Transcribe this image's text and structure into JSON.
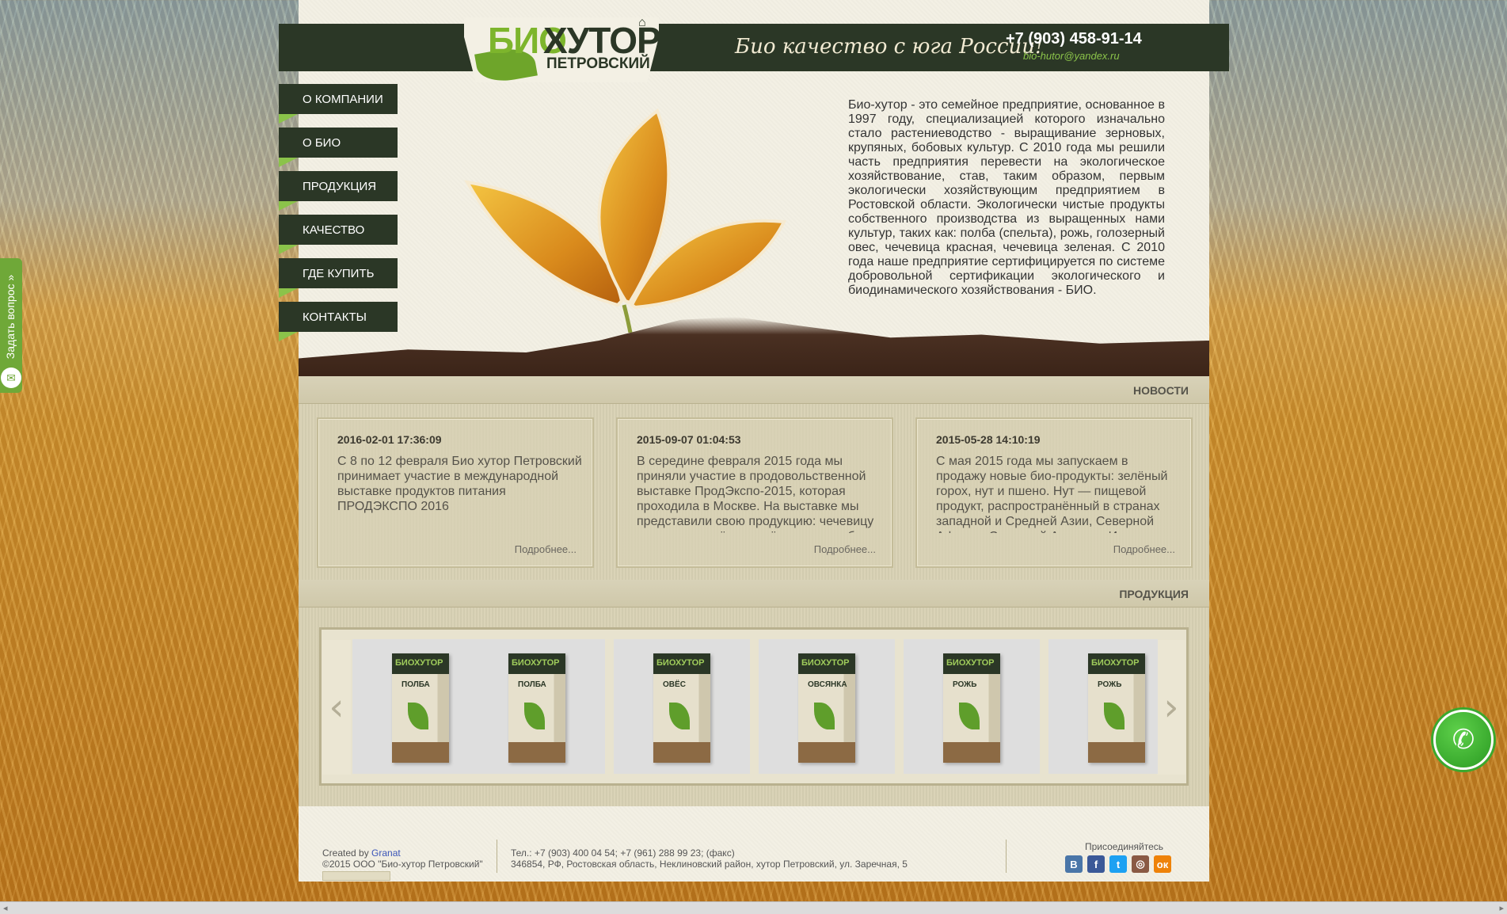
{
  "header": {
    "logo_bio": "БИО",
    "logo_hutor": "ХУТОР",
    "logo_petrovsky": "ПЕТРОВСКИЙ",
    "slogan": "Био качество с юга России!",
    "phone": "+7 (903) 458-91-14",
    "email": "bio-hutor@yandex.ru"
  },
  "nav": {
    "items": [
      {
        "label": "О КОМПАНИИ"
      },
      {
        "label": "О БИО"
      },
      {
        "label": "ПРОДУКЦИЯ"
      },
      {
        "label": "КАЧЕСТВО"
      },
      {
        "label": "ГДЕ КУПИТЬ"
      },
      {
        "label": "КОНТАКТЫ"
      }
    ]
  },
  "intro": {
    "text": "Био-хутор - это семейное предприятие, основанное в 1997 году, специализацией которого изначально стало растениеводство - выращивание зерновых, крупяных, бобовых культур. С 2010 года мы решили часть предприятия перевести на экологическое хозяйствование, став, таким образом, первым экологически хозяйствующим предприятием в Ростовской области. Экологически чистые продукты собственного производства из выращенных нами культур, таких как: полба (спельта), рожь, голозерный овес, чечевица красная, чечевица зеленая. С 2010 года наше предприятие сертифицируется по системе добровольной сертификации экологического и биодинамического хозяйствования - БИО."
  },
  "news": {
    "title": "НОВОСТИ",
    "more_label": "Подробнее...",
    "items": [
      {
        "date": "2016-02-01 17:36:09",
        "text": "С 8 по 12 февраля Био хутор Петровский принимает участие в международной выставке продуктов питания ПРОДЭКСПО 2016"
      },
      {
        "date": "2015-09-07 01:04:53",
        "text": "В середине февраля 2015 года мы приняли участие в продовольственной выставке ПродЭкспо-2015, которая проходила в Москве. На выставке мы представили свою продукцию: чечевицу красную и зелёную, овёс, рожь, полбу"
      },
      {
        "date": "2015-05-28 14:10:19",
        "text": "С мая 2015 года мы запускаем в продажу новые био-продукты: зелёный горох, нут и пшено. Нут — пищевой продукт, распространённый в странах западной и Средней Азии, Северной Африки, Северной Америки. Из него готовят"
      }
    ]
  },
  "products": {
    "title": "ПРОДУКЦИЯ",
    "prev_arrow": "‹",
    "next_arrow": "›",
    "items": [
      {
        "brand": "БИОХУТОР",
        "name": "ПОЛБА"
      },
      {
        "brand": "БИОХУТОР",
        "name": "ПОЛБА"
      },
      {
        "brand": "БИОХУТОР",
        "name": "ОВЁС"
      },
      {
        "brand": "БИОХУТОР",
        "name": "ОВСЯНКА"
      },
      {
        "brand": "БИОХУТОР",
        "name": "РОЖЬ"
      },
      {
        "brand": "БИОХУТОР",
        "name": "РОЖЬ"
      }
    ]
  },
  "footer": {
    "created_by": "Created by",
    "created_link": "Granat",
    "copyright": "©2015 ООО \"Био-хутор Петровский\"",
    "phones": "Тел.: +7 (903) 400 04 54; +7 (961) 288 99 23; (факс)",
    "address": "346854, РФ, Ростовская область, Неклиновский район, хутор Петровский, ул. Заречная, 5",
    "join_label": "Присоединяйтесь",
    "social": [
      {
        "glyph": "В",
        "color": "#4a76a8"
      },
      {
        "glyph": "f",
        "color": "#3b5998"
      },
      {
        "glyph": "t",
        "color": "#1da1f2"
      },
      {
        "glyph": "◎",
        "color": "#8a5a44"
      },
      {
        "glyph": "ок",
        "color": "#ee8208"
      }
    ]
  },
  "widgets": {
    "ask_label": "Задать вопрос »",
    "mail_glyph": "✉",
    "call_glyph": "✆"
  },
  "bottom_strip": {
    "left_arrow": "◂",
    "right_arrow": "▸"
  }
}
